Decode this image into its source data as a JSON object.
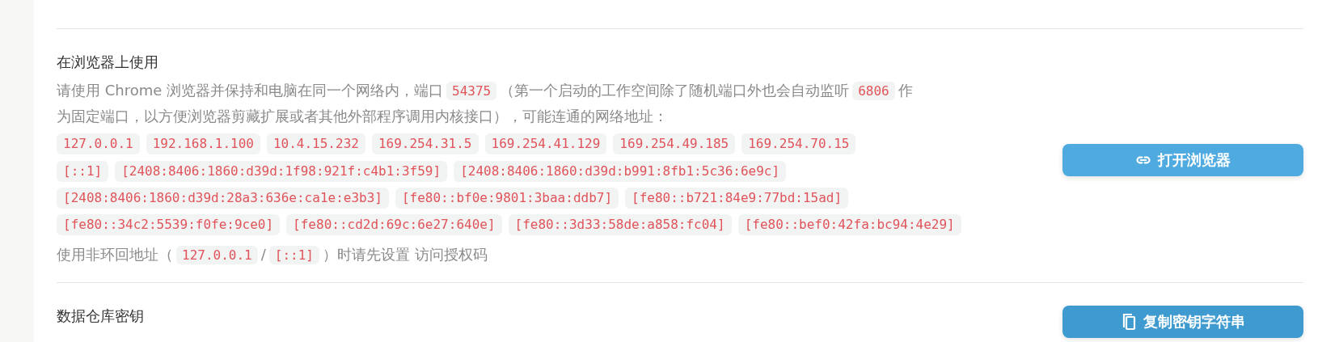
{
  "sections": [
    {
      "title": "在浏览器上使用",
      "description_lines": [
        [
          {
            "kind": "text",
            "text": "请使用 Chrome 浏览器并保持和电脑在同一个网络内，端口"
          },
          {
            "kind": "code",
            "text": "54375"
          },
          {
            "kind": "text",
            "text": "（第一个启动的工作空间除了随机端口外也会自动监听"
          },
          {
            "kind": "code",
            "text": "6806"
          },
          {
            "kind": "text",
            "text": "作"
          }
        ],
        [
          {
            "kind": "text",
            "text": "为固定端口，以方便浏览器剪藏扩展或者其他外部程序调用内核接口），可能连通的网络地址："
          }
        ]
      ],
      "address_groups": [
        [
          "127.0.0.1",
          "192.168.1.100",
          "10.4.15.232",
          "169.254.31.5",
          "169.254.41.129",
          "169.254.49.185",
          "169.254.70.15"
        ],
        [
          "[::1]",
          "[2408:8406:1860:d39d:1f98:921f:c4b1:3f59]",
          "[2408:8406:1860:d39d:b991:8fb1:5c36:6e9c]",
          "[2408:8406:1860:d39d:28a3:636e:ca1e:e3b3]",
          "[fe80::bf0e:9801:3baa:ddb7]",
          "[fe80::b721:84e9:77bd:15ad]",
          "[fe80::34c2:5539:f0fe:9ce0]",
          "[fe80::cd2d:69c:6e27:640e]",
          "[fe80::3d33:58de:a858:fc04]",
          "[fe80::bef0:42fa:bc94:4e29]"
        ]
      ],
      "note": [
        {
          "kind": "text",
          "text": "使用非环回地址（"
        },
        {
          "kind": "code",
          "text": "127.0.0.1"
        },
        {
          "kind": "text",
          "text": "/"
        },
        {
          "kind": "code",
          "text": "[::1]"
        },
        {
          "kind": "text",
          "text": "）时请先设置 访问授权码"
        }
      ],
      "button": {
        "label": "打开浏览器",
        "kind": "link"
      }
    },
    {
      "title": "数据仓库密钥",
      "button": {
        "label": "复制密钥字符串",
        "kind": "copy"
      }
    }
  ]
}
